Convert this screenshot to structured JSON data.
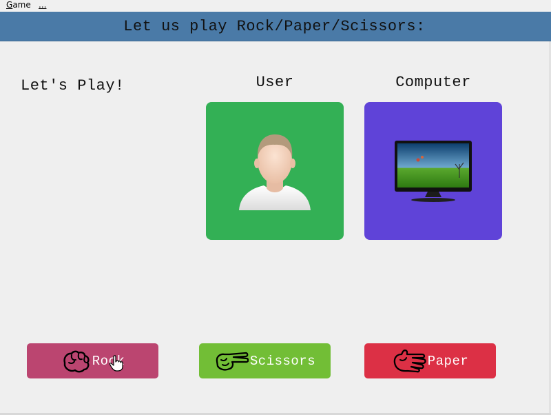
{
  "menu": {
    "game": "Game",
    "more": "..."
  },
  "banner": {
    "title": "Let us play Rock/Paper/Scissors:"
  },
  "status": {
    "text": "Let's Play!"
  },
  "players": {
    "user": {
      "label": "User",
      "icon": "user-avatar-icon"
    },
    "computer": {
      "label": "Computer",
      "icon": "monitor-icon"
    }
  },
  "buttons": {
    "rock": {
      "label": "Rock",
      "icon": "rock-hand-icon"
    },
    "scissors": {
      "label": "Scissors",
      "icon": "scissors-hand-icon"
    },
    "paper": {
      "label": "Paper",
      "icon": "paper-hand-icon"
    }
  },
  "colors": {
    "banner": "#4a7aa7",
    "user_tile": "#33b055",
    "computer_tile": "#5f43d8",
    "rock": "#bb4570",
    "scissors": "#72be36",
    "paper": "#dc3045"
  }
}
